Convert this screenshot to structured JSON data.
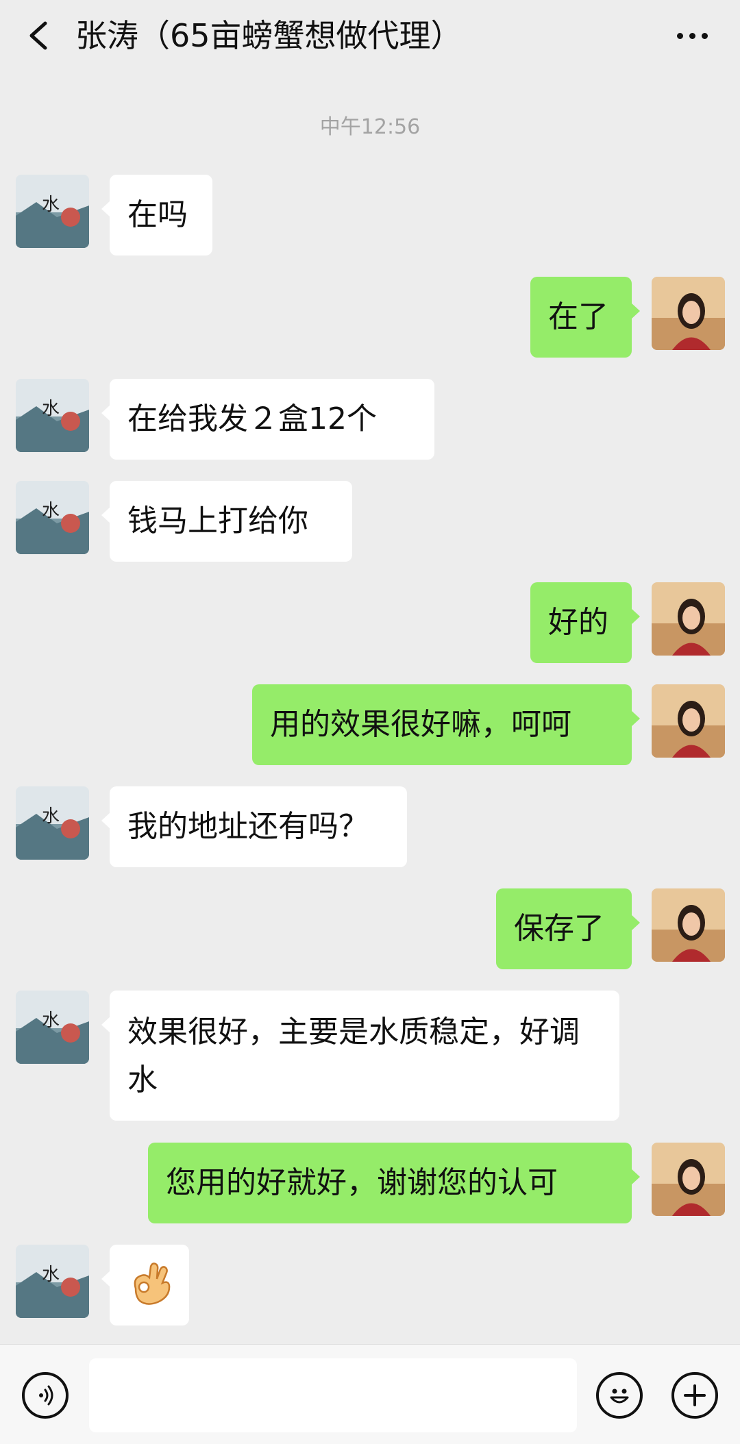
{
  "header": {
    "title": "张涛（65亩螃蟹想做代理）"
  },
  "timestamp": "中午12:56",
  "messages": [
    {
      "side": "in",
      "text": "在吗"
    },
    {
      "side": "out",
      "text": "在了"
    },
    {
      "side": "in",
      "text": "在给我发２盒12个"
    },
    {
      "side": "in",
      "text": "钱马上打给你"
    },
    {
      "side": "out",
      "text": "好的"
    },
    {
      "side": "out",
      "text": "用的效果很好嘛，呵呵"
    },
    {
      "side": "in",
      "text": "我的地址还有吗？"
    },
    {
      "side": "out",
      "text": "保存了"
    },
    {
      "side": "in",
      "text": "效果很好，主要是水质稳定，好调水"
    },
    {
      "side": "out",
      "text": "您用的好就好，谢谢您的认可"
    },
    {
      "side": "in",
      "emoji": "ok-hand-emoji"
    }
  ],
  "colors": {
    "background": "#ededed",
    "out_bubble": "#95ec69",
    "in_bubble": "#ffffff"
  },
  "icons": {
    "back": "chevron-left-icon",
    "more": "more-dots-icon",
    "voice": "voice-icon",
    "emoji": "emoji-icon",
    "plus": "plus-icon"
  }
}
